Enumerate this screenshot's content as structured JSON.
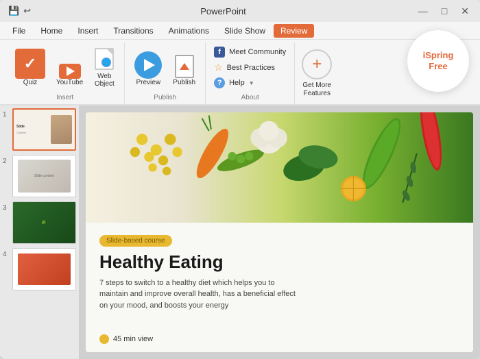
{
  "window": {
    "title": "PowerPoint",
    "controls": {
      "minimize": "—",
      "maximize": "□",
      "close": "✕"
    }
  },
  "titlebar": {
    "left_icons": [
      "save",
      "undo"
    ],
    "title": "PowerPoint"
  },
  "menubar": {
    "items": [
      "File",
      "Home",
      "Insert",
      "Transitions",
      "Animations",
      "Slide Show",
      "Review"
    ]
  },
  "ribbon": {
    "groups": {
      "insert": {
        "label": "Insert",
        "items": [
          "Quiz",
          "YouTube",
          "Web Object"
        ]
      },
      "publish": {
        "label": "Publish",
        "items": [
          "Preview",
          "Publish"
        ]
      },
      "about": {
        "label": "About",
        "items": [
          "Meet Community",
          "Best Practices",
          "Help"
        ]
      }
    },
    "get_more": {
      "label": "Get More\nFeatures"
    },
    "badge": {
      "line1": "iSpring",
      "line2": "Free"
    }
  },
  "slides": [
    {
      "num": "1",
      "active": true
    },
    {
      "num": "2",
      "active": false
    },
    {
      "num": "3",
      "active": false
    },
    {
      "num": "4",
      "active": false
    }
  ],
  "slide_content": {
    "badge": "Slide-based course",
    "title": "Healthy Eating",
    "description": "7 steps to switch to a healthy diet which helps you to maintain and improve overall health, has a beneficial effect on your mood, and boosts your energy",
    "duration": "45 min view"
  }
}
